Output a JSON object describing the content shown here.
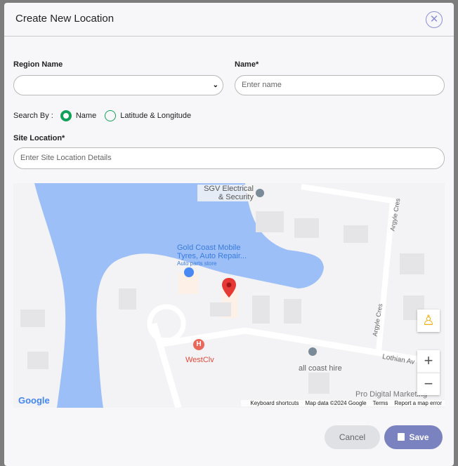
{
  "modal": {
    "title": "Create New Location",
    "close_icon": "close-icon"
  },
  "form": {
    "region_label": "Region Name",
    "region_value": "",
    "name_label": "Name*",
    "name_placeholder": "Enter name",
    "search_by_label": "Search By :",
    "options": [
      "Name",
      "Latitude & Longitude"
    ],
    "selected_option": "Name",
    "site_label": "Site Location*",
    "site_placeholder": "Enter Site Location Details"
  },
  "map": {
    "places": [
      "SGV Electrical & Security",
      "Gold Coast Mobile",
      "Tyres, Auto Repair...",
      "Auto parts store",
      "WestClv",
      "all coast hire",
      "Pro Digital Marketing"
    ],
    "streets": [
      "Argyle Cres",
      "Argyle Cres",
      "Lothian Av"
    ],
    "logo": "Google",
    "footer": [
      "Keyboard shortcuts",
      "Map data ©2024 Google",
      "Terms",
      "Report a map error"
    ],
    "zoom_in": "+",
    "zoom_out": "−",
    "water_color": "#9cbff7",
    "marker_color": "#e53935"
  },
  "buttons": {
    "cancel": "Cancel",
    "save": "Save"
  },
  "colors": {
    "accent": "#13a05a",
    "save_bg": "#7b82c0",
    "cancel_bg": "#dfe1e5"
  }
}
